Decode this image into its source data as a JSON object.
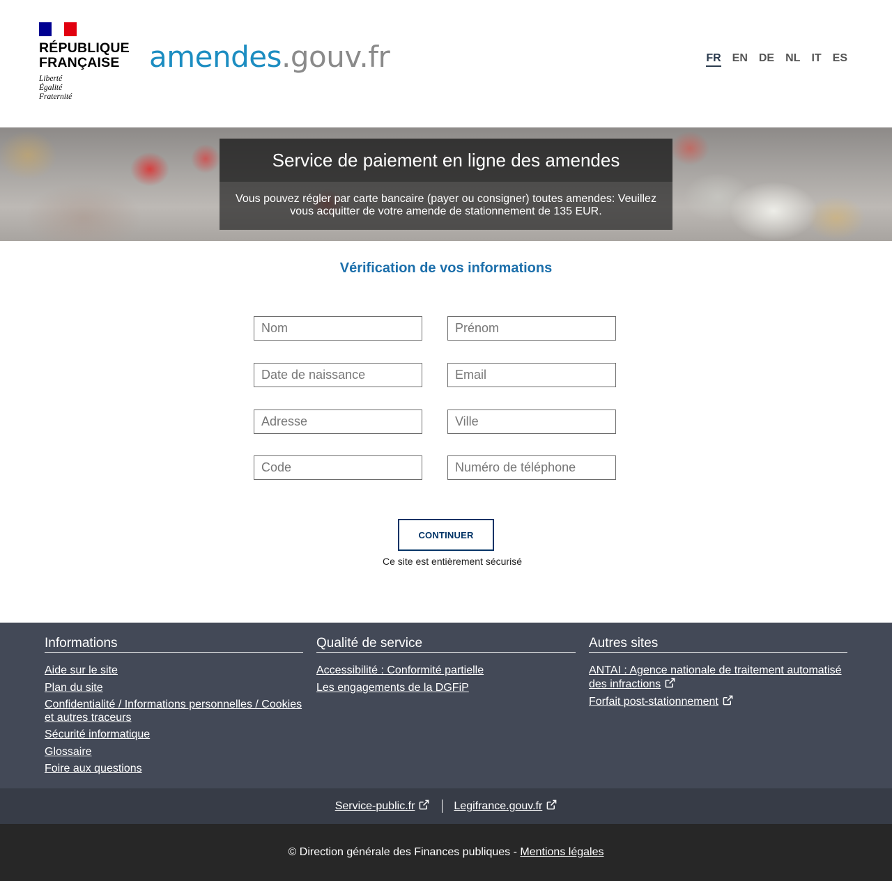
{
  "header": {
    "republique": "RÉPUBLIQUE\nFRANÇAISE",
    "motto": "Liberté\nÉgalité\nFraternité",
    "site_logo_main": "amendes",
    "site_logo_suffix": ".gouv.fr",
    "languages": [
      "FR",
      "EN",
      "DE",
      "NL",
      "IT",
      "ES"
    ],
    "active_language": "FR"
  },
  "banner": {
    "title": "Service de paiement en ligne des amendes",
    "text": "Vous pouvez régler par carte bancaire (payer ou consigner) toutes amendes: Veuillez vous acquitter de votre amende de stationnement de 135 EUR."
  },
  "form": {
    "title": "Vérification de vos informations",
    "fields": {
      "nom": "Nom",
      "prenom": "Prénom",
      "date_naissance": "Date de naissance",
      "email": "Email",
      "adresse": "Adresse",
      "ville": "Ville",
      "code": "Code",
      "telephone": "Numéro de téléphone"
    },
    "submit_label": "CONTINUER",
    "secure_note": "Ce site est entièrement sécurisé"
  },
  "footer": {
    "informations": {
      "title": "Informations",
      "links": [
        "Aide sur le site",
        "Plan du site",
        "Confidentialité / Informations personnelles / Cookies et autres traceurs",
        "Sécurité informatique",
        "Glossaire",
        "Foire aux questions"
      ]
    },
    "qualite": {
      "title": "Qualité de service",
      "links": [
        "Accessibilité : Conformité partielle",
        "Les engagements de la DGFiP"
      ]
    },
    "autres": {
      "title": "Autres sites",
      "links": [
        "ANTAI : Agence nationale de traitement automatisé des infractions",
        "Forfait post-stationnement"
      ]
    },
    "external": [
      "Service-public.fr",
      "Legifrance.gouv.fr"
    ],
    "copyright": "© Direction générale des Finances publiques - ",
    "mentions": "Mentions légales"
  },
  "colors": {
    "flag_blue": "#000091",
    "flag_red": "#e1000f",
    "logo_blue": "#1c8dc1",
    "title_blue": "#1c6fab",
    "button_navy": "#003366",
    "footer_bg": "#434957"
  },
  "icons": [
    "external-link-icon"
  ]
}
